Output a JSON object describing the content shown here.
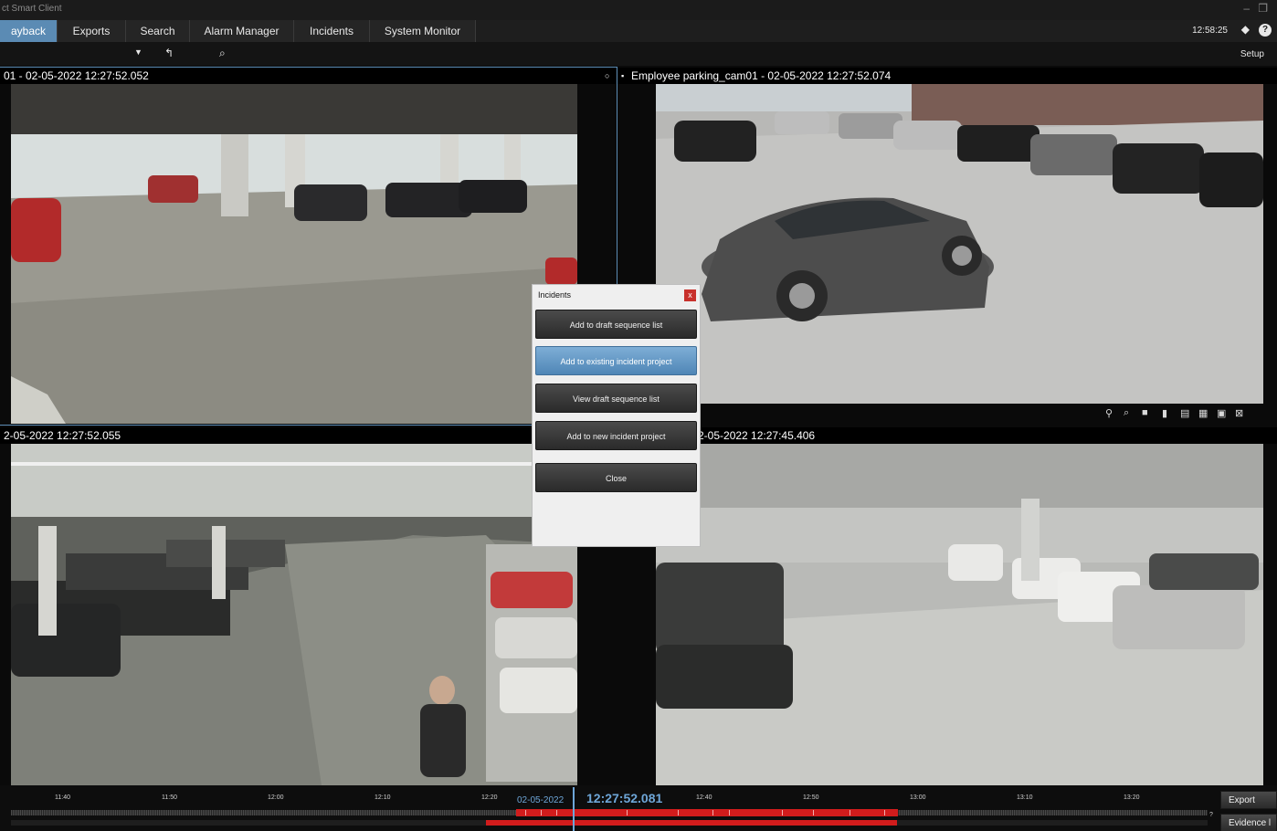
{
  "window": {
    "title": "ct Smart Client"
  },
  "tabs": [
    {
      "label": "ayback",
      "active": true
    },
    {
      "label": "Exports",
      "active": false
    },
    {
      "label": "Search",
      "active": false
    },
    {
      "label": "Alarm Manager",
      "active": false
    },
    {
      "label": "Incidents",
      "active": false
    },
    {
      "label": "System Monitor",
      "active": false
    }
  ],
  "header": {
    "clock": "12:58:25",
    "setup_label": "Setup"
  },
  "icons": {
    "dropdown": "chevron-down-icon",
    "undo": "undo-icon",
    "search_sequence": "search-sequence-icon",
    "lock": "lock-icon",
    "help": "help-icon"
  },
  "cameras": [
    {
      "id": "top-left",
      "header": "01 - 02-05-2022 12:27:52.052"
    },
    {
      "id": "top-right",
      "header": "Employee parking_cam01 - 02-05-2022 12:27:52.074"
    },
    {
      "id": "bottom-left",
      "header": "2-05-2022 12:27:52.055"
    },
    {
      "id": "bottom-right",
      "header": "2-05-2022 12:27:45.406"
    }
  ],
  "dialog": {
    "title": "Incidents",
    "close_x": "x",
    "buttons": [
      {
        "label": "Add to draft sequence list",
        "highlighted": false
      },
      {
        "label": "Add to existing incident project",
        "highlighted": true
      },
      {
        "label": "View draft sequence list",
        "highlighted": false
      },
      {
        "label": "Add to new incident project",
        "highlighted": false
      },
      {
        "label": "Close",
        "highlighted": false
      }
    ]
  },
  "timeline": {
    "date": "02-05-2022",
    "time": "12:27:52.081",
    "tick_labels": [
      "11:40",
      "11:50",
      "12:00",
      "12:10",
      "12:20",
      "12:40",
      "12:50",
      "13:00",
      "13:10",
      "13:20"
    ],
    "export_label": "Export",
    "evidence_label": "Evidence l",
    "question": "?"
  },
  "colors": {
    "accent": "#5b8bb4",
    "recording": "#d11c1c",
    "timeline_text": "#6ea6d8"
  }
}
